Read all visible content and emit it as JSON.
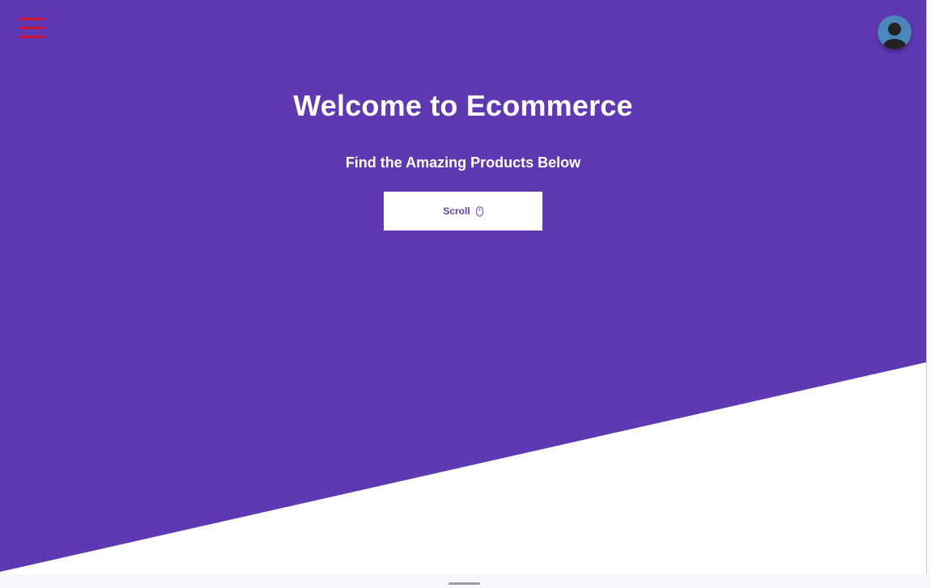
{
  "hero": {
    "title": "Welcome to Ecommerce",
    "subtitle": "Find the Amazing Products Below",
    "scroll_button_label": "Scroll"
  },
  "icons": {
    "menu": "hamburger-menu-icon",
    "profile": "user-avatar-icon",
    "scroll": "mouse-icon"
  },
  "colors": {
    "hero_background": "#5f39b3",
    "menu_icon": "#d1122f",
    "avatar_background": "#4b86bd",
    "button_text": "#5e3bb2"
  }
}
